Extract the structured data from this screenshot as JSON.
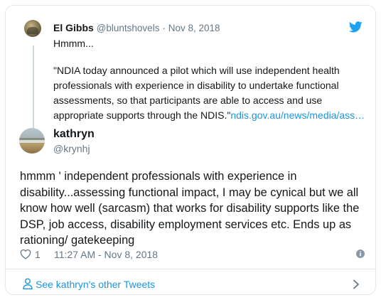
{
  "parent_tweet": {
    "name": "El Gibbs",
    "handle": "@bluntshovels",
    "separator": "·",
    "date": "Nov 8, 2018",
    "text": "Hmmm...",
    "quote_lines": [
      "\"NDIA today announced a pilot which will use independent health",
      "professionals with experience in disability to undertake functional",
      "assessments, so that participants are able to access and use",
      "appropriate supports through the NDIS.\""
    ],
    "link_text": "ndis.gov.au/news/media/ass…"
  },
  "main_tweet": {
    "name": "kathryn",
    "handle": "@krynhj",
    "text_lines": [
      "hmmm ' independent professionals with experience in",
      "disability...assessing functional impact, I may be cynical but we all",
      "know how well (sarcasm)  that works for  disability supports like the",
      "DSP, job access, disability employment services etc. Ends up as",
      "rationing/ gatekeeping"
    ],
    "like_count": "1",
    "timestamp": "11:27 AM - Nov 8, 2018"
  },
  "footer": {
    "see_more_label": "See kathryn's other Tweets"
  },
  "icons": {
    "brand": "twitter-bird-icon",
    "like": "heart-icon",
    "info": "info-icon",
    "person": "person-icon",
    "chevron": "chevron-right-icon"
  },
  "colors": {
    "link": "#1b95e0",
    "muted": "#657786",
    "border": "#e1e8ed",
    "twitter_blue": "#1da1f2"
  }
}
